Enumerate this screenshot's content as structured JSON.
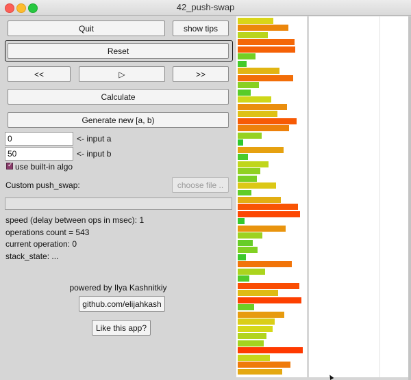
{
  "window": {
    "title": "42_push-swap"
  },
  "controls": {
    "quit": "Quit",
    "show_tips": "show tips",
    "reset": "Reset",
    "step_back": "<<",
    "play": "▷",
    "step_forward": ">>",
    "calculate": "Calculate",
    "generate": "Generate new [a, b)"
  },
  "inputs": {
    "a_value": "0",
    "a_label": "<- input a",
    "b_value": "50",
    "b_label": "<- input b"
  },
  "builtin": {
    "label": "use built-in algo",
    "checked": true
  },
  "custom": {
    "label": "Custom push_swap:",
    "choose_file": "choose file .."
  },
  "status": {
    "speed": "speed (delay between ops in msec): 1",
    "ops_count": "operations count = 543",
    "current_op": "current operation: 0",
    "stack_state": "stack_state: ..."
  },
  "footer": {
    "powered_by": "powered by Ilya Kashnitkiy",
    "github": "github.com/elijahkash",
    "like": "Like this app?"
  },
  "stack_a": {
    "values": [
      25,
      37,
      20,
      42,
      43,
      10,
      3,
      30,
      41,
      13,
      6,
      23,
      36,
      28,
      44,
      38,
      15,
      0,
      33,
      4,
      21,
      14,
      11,
      27,
      7,
      31,
      45,
      47,
      1,
      35,
      16,
      8,
      12,
      2,
      40,
      18,
      5,
      46,
      29,
      48,
      9,
      34,
      26,
      24,
      19,
      17,
      49,
      22,
      39,
      32
    ]
  },
  "colors": {
    "low": "#2ec82e",
    "mid": "#d8d818",
    "high": "#ff3a00"
  }
}
